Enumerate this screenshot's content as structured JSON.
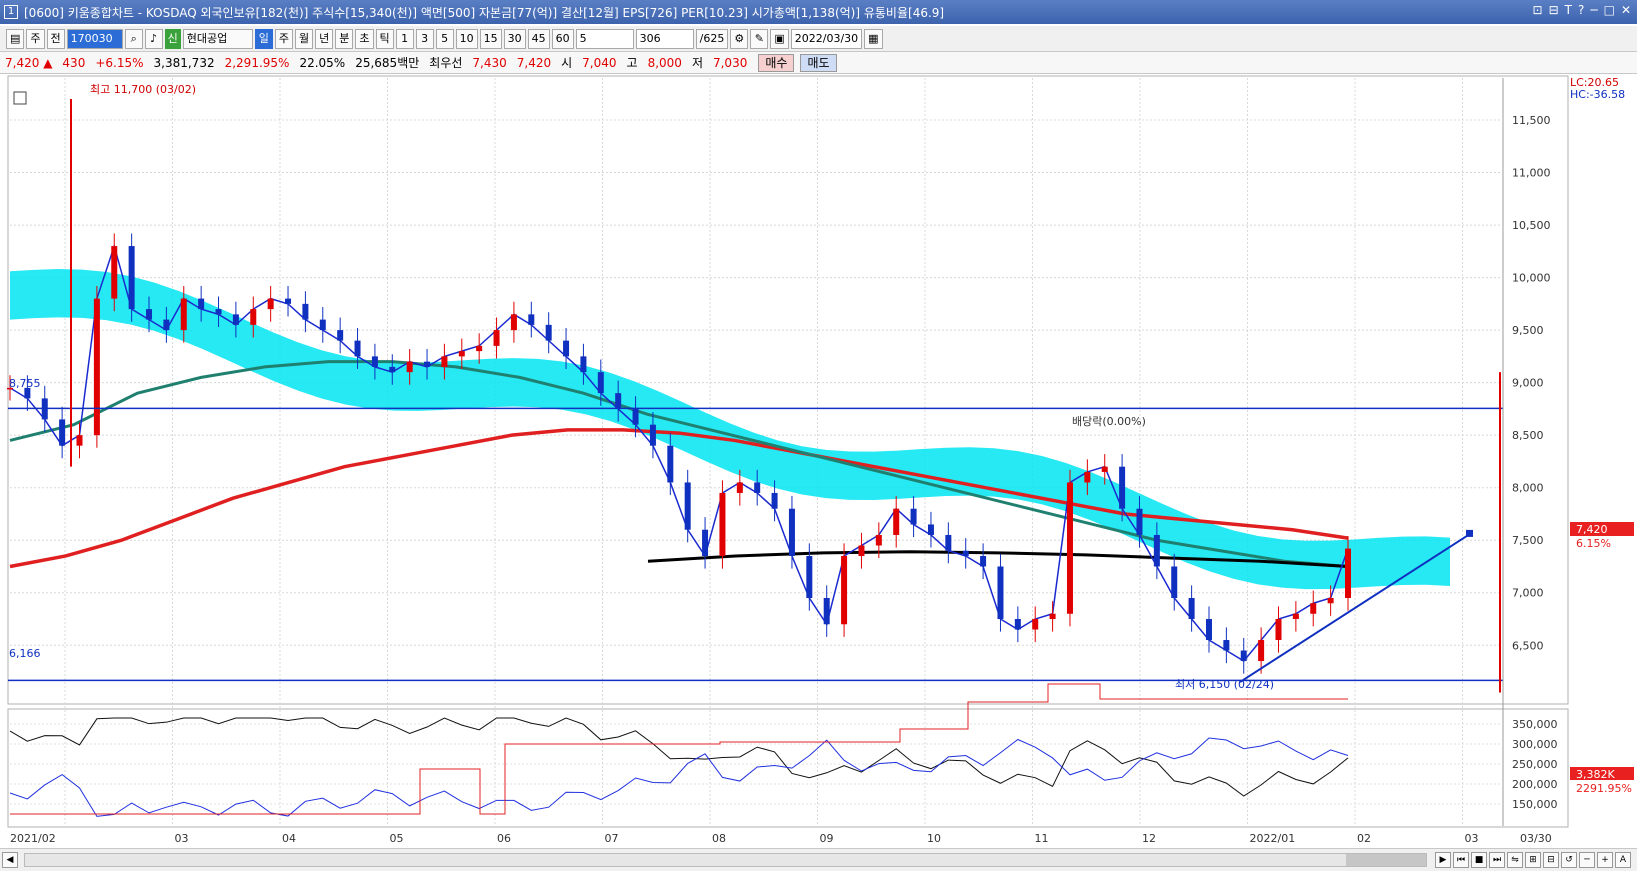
{
  "window": {
    "title_num": "1",
    "title": "[0600] 키움종합차트 - KOSDAQ 외국인보유[182(천)] 주식수[15,340(천)] 액면[500] 자본금[77(억)] 결산[12월] EPS[726] PER[10.23] 시가총액[1,138(억)] 유통비율[46.9]",
    "buttons": [
      "⊡",
      "⊟",
      "T",
      "?",
      "─",
      "□",
      "✕"
    ]
  },
  "toolbar": {
    "period": "주",
    "prev": "전",
    "code": "170030",
    "badge": "신",
    "stock_name": "현대공업",
    "intervals": [
      "일",
      "주",
      "월",
      "년",
      "분",
      "초",
      "틱"
    ],
    "selected_interval": "일",
    "numbers": [
      "1",
      "3",
      "5",
      "10",
      "15",
      "30",
      "45",
      "60"
    ],
    "count": "5",
    "range": "306",
    "range_total": "/625",
    "date": "2022/03/30"
  },
  "quote": {
    "price": "7,420",
    "arrow": "▲",
    "change": "430",
    "change_pct": "+6.15%",
    "volume": "3,381,732",
    "vol_ratio": "2,291.95%",
    "turnover": "22.05%",
    "amount": "25,685백만",
    "best_label": "최우선",
    "best_ask": "7,430",
    "best_bid": "7,420",
    "open_label": "시",
    "open": "7,040",
    "high_label": "고",
    "high": "8,000",
    "low_label": "저",
    "low": "7,030",
    "buy": "매수",
    "sell": "매도"
  },
  "chart_data": {
    "type": "candlestick",
    "price_axis_ticks": [
      "11,500",
      "11,000",
      "10,500",
      "10,000",
      "9,500",
      "9,000",
      "8,500",
      "8,000",
      "7,500",
      "7,000",
      "6,500"
    ],
    "lc_label": "LC:20.65",
    "hc_label": "HC:-36.58",
    "current_price_label": "7,420",
    "current_pct_label": "6.15%",
    "high_annotation": "최고 11,700 (03/02)",
    "low_annotation": "최저 6,150 (02/24)",
    "dividend_annotation": "배당락(0.00%)",
    "hline_upper_label": "8,755",
    "hline_lower_label": "6,166",
    "hline_upper": 8755,
    "hline_lower": 6166,
    "ylim": [
      5960,
      11900
    ],
    "x_labels": [
      "2021/02",
      "03",
      "04",
      "05",
      "06",
      "07",
      "08",
      "09",
      "10",
      "11",
      "12",
      "2022/01",
      "02",
      "03",
      "03/30"
    ],
    "close_series": [
      8950,
      8850,
      8650,
      8400,
      8500,
      9800,
      10300,
      9700,
      9600,
      9500,
      9800,
      9700,
      9650,
      9550,
      9700,
      9800,
      9750,
      9600,
      9500,
      9400,
      9250,
      9150,
      9100,
      9200,
      9150,
      9250,
      9300,
      9350,
      9500,
      9650,
      9550,
      9400,
      9250,
      9100,
      8900,
      8750,
      8600,
      8400,
      8050,
      7600,
      7350,
      7950,
      8050,
      7950,
      7800,
      7350,
      6950,
      6700,
      7350,
      7450,
      7550,
      7800,
      7650,
      7550,
      7400,
      7350,
      7250,
      6750,
      6650,
      6750,
      6800,
      8050,
      8150,
      8200,
      7800,
      7550,
      7250,
      6950,
      6750,
      6550,
      6450,
      6350,
      6550,
      6750,
      6800,
      6900,
      6950,
      7420
    ],
    "ma_long_red": [
      7250,
      7350,
      7500,
      7700,
      7900,
      8050,
      8200,
      8300,
      8400,
      8500,
      8550,
      8550,
      8520,
      8450,
      8350,
      8250,
      8150,
      8050,
      7950,
      7850,
      7750,
      7700,
      7650,
      7600,
      7520
    ],
    "ma_green": [
      8450,
      8600,
      8900,
      9050,
      9150,
      9200,
      9200,
      9150,
      9050,
      8900,
      8700,
      8550,
      8400,
      8250,
      8100,
      7950,
      7800,
      7650,
      7500,
      7400,
      7300,
      7250
    ],
    "trend_black": [
      7300,
      7350,
      7380,
      7390,
      7380,
      7360,
      7330,
      7300,
      7250
    ],
    "indicator_ticks": [
      "350,000",
      "300,000",
      "250,000",
      "200,000",
      "150,000"
    ],
    "indicator_last": "3,382K",
    "indicator_pct": "2291.95%"
  },
  "statusbar": {
    "arrow_left": "◀",
    "arrow_right": "▶",
    "controls": [
      "⏮",
      "■",
      "⏭"
    ],
    "tools": [
      "⇋",
      "⊞",
      "⊟",
      "↺",
      "─",
      "+",
      "A"
    ]
  }
}
